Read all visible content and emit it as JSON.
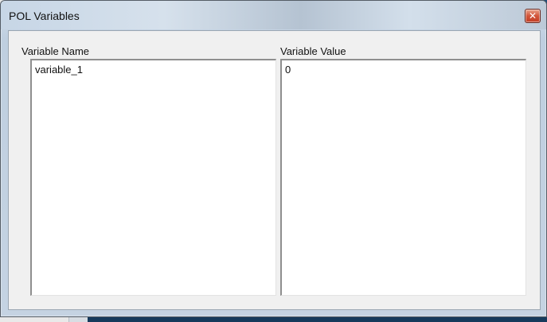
{
  "window": {
    "title": "POL Variables"
  },
  "columns": {
    "name_header": "Variable Name",
    "value_header": "Variable Value"
  },
  "variables": {
    "names": [
      "variable_1"
    ],
    "values": [
      "0"
    ]
  },
  "icons": {
    "close": "close-icon"
  },
  "colors": {
    "close_button": "#c94a30",
    "desktop": "#1f4e79"
  }
}
